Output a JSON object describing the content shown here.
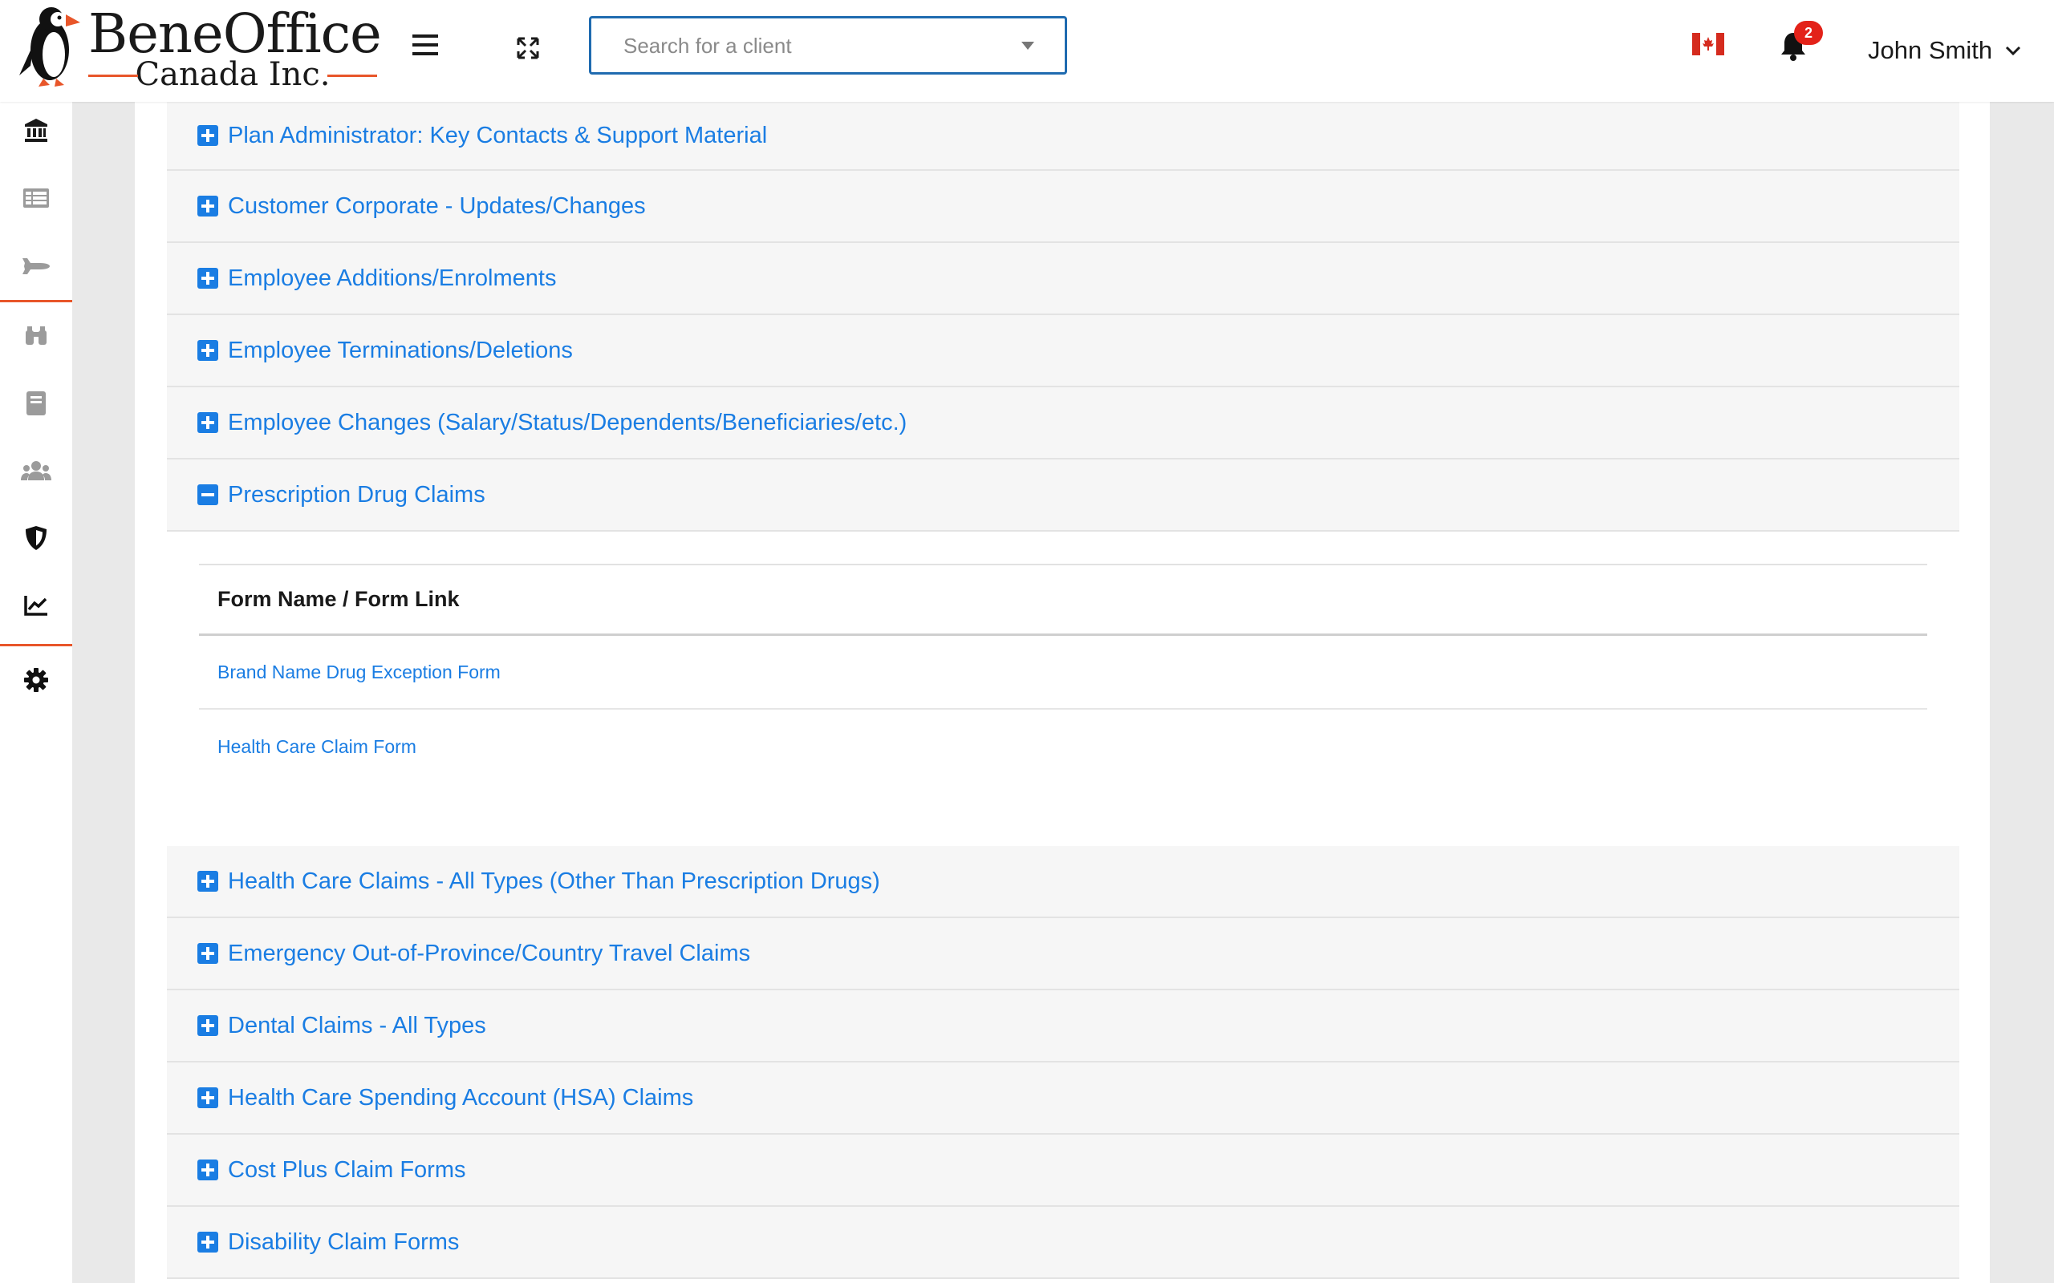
{
  "header": {
    "brand_main": "BeneOffice",
    "brand_sub": "Canada Inc.",
    "search": {
      "placeholder": "Search for a client"
    },
    "notifications": {
      "count": "2"
    },
    "user": {
      "name": "John Smith"
    }
  },
  "colors": {
    "accent": "#1a7de3",
    "brand_orange": "#e8562a",
    "badge_red": "#e32219",
    "flag_red": "#d52b1e"
  },
  "sidebar": {
    "items": [
      {
        "icon": "bank-icon"
      },
      {
        "icon": "list-icon"
      },
      {
        "icon": "airplane-icon"
      },
      {
        "icon": "binoculars-icon"
      },
      {
        "icon": "book-icon"
      },
      {
        "icon": "users-icon"
      },
      {
        "icon": "shield-icon"
      },
      {
        "icon": "chart-line-icon"
      },
      {
        "icon": "gear-icon"
      }
    ]
  },
  "accordion": {
    "sections": [
      {
        "label": "Plan Administrator: Key Contacts & Support Material",
        "expanded": false
      },
      {
        "label": "Customer Corporate - Updates/Changes",
        "expanded": false
      },
      {
        "label": "Employee Additions/Enrolments",
        "expanded": false
      },
      {
        "label": "Employee Terminations/Deletions",
        "expanded": false
      },
      {
        "label": "Employee Changes (Salary/Status/Dependents/Beneficiaries/etc.)",
        "expanded": false
      },
      {
        "label": "Prescription Drug Claims",
        "expanded": true
      },
      {
        "label": "Health Care Claims - All Types (Other Than Prescription Drugs)",
        "expanded": false
      },
      {
        "label": "Emergency Out-of-Province/Country Travel Claims",
        "expanded": false
      },
      {
        "label": "Dental Claims - All Types",
        "expanded": false
      },
      {
        "label": "Health Care Spending Account (HSA) Claims",
        "expanded": false
      },
      {
        "label": "Cost Plus Claim Forms",
        "expanded": false
      },
      {
        "label": "Disability Claim Forms",
        "expanded": false
      }
    ],
    "expanded_table": {
      "header": "Form Name / Form Link",
      "rows": [
        "Brand Name Drug Exception Form",
        "Health Care Claim Form"
      ]
    }
  }
}
